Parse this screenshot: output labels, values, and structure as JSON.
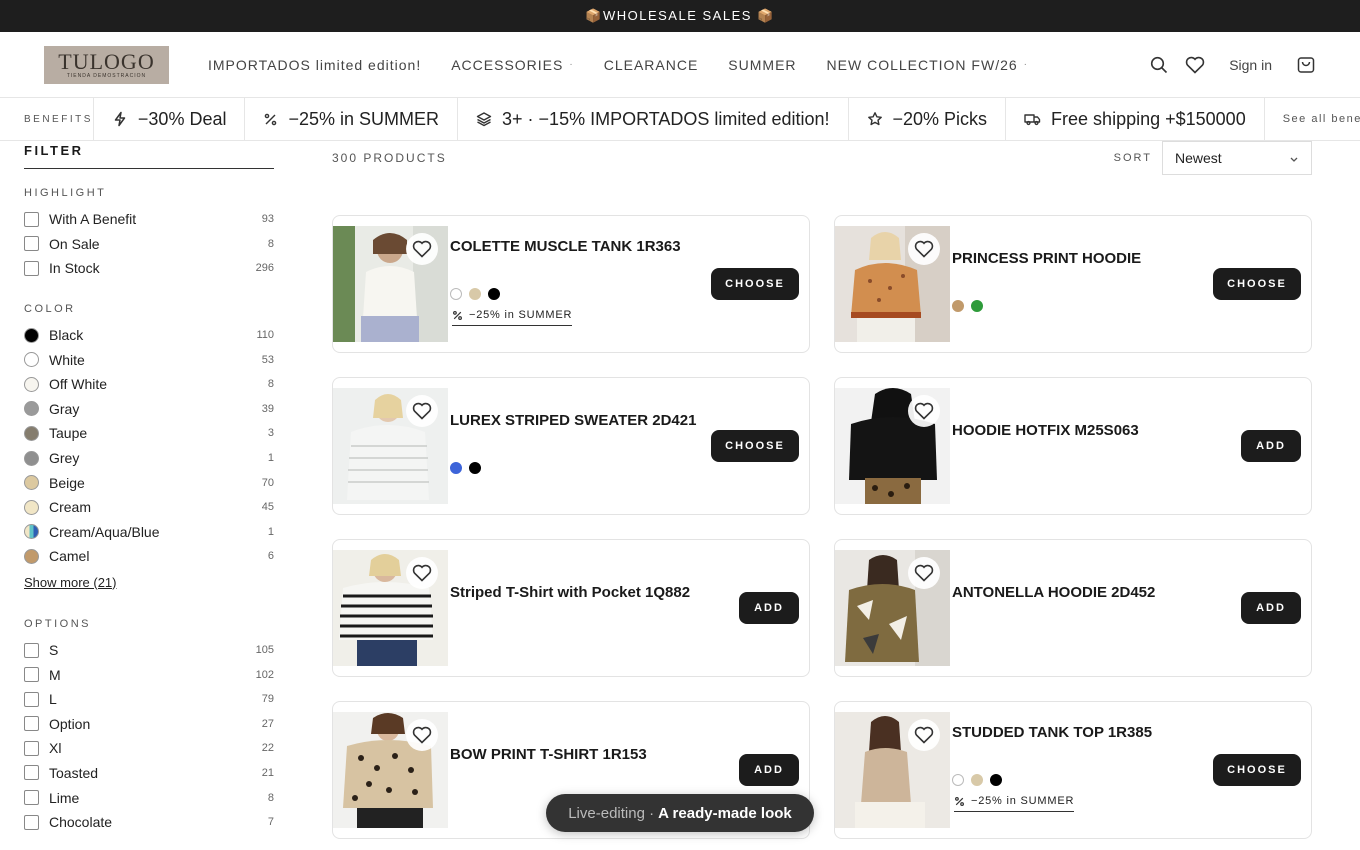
{
  "topbar": {
    "text": "📦WHOLESALE SALES 📦"
  },
  "logo": {
    "main": "TULOGO",
    "sub": "TIENDA DEMOSTRACION"
  },
  "nav": [
    {
      "label": "IMPORTADOS limited edition!",
      "dropdown": false
    },
    {
      "label": "ACCESSORIES",
      "dropdown": true
    },
    {
      "label": "CLEARANCE",
      "dropdown": false
    },
    {
      "label": "SUMMER",
      "dropdown": false
    },
    {
      "label": "NEW COLLECTION FW/26",
      "dropdown": true
    }
  ],
  "header": {
    "signin": "Sign in",
    "icons": [
      "search-icon",
      "heart-icon",
      "cart-icon"
    ]
  },
  "benefits": {
    "label": "BENEFITS",
    "items": [
      {
        "icon": "bolt-icon",
        "text": "−30% Deal"
      },
      {
        "icon": "percent-icon",
        "text": "−25% in SUMMER"
      },
      {
        "icon": "layers-icon",
        "text": "3+ · −15% IMPORTADOS limited edition!"
      },
      {
        "icon": "star-icon",
        "text": "−20% Picks"
      },
      {
        "icon": "truck-icon",
        "text": "Free shipping +$150000"
      }
    ],
    "see_all": "See all benefits →"
  },
  "filter": {
    "title": "FILTER",
    "highlight": {
      "title": "HIGHLIGHT",
      "items": [
        {
          "label": "With A Benefit",
          "count": "93"
        },
        {
          "label": "On Sale",
          "count": "8"
        },
        {
          "label": "In Stock",
          "count": "296"
        }
      ]
    },
    "color": {
      "title": "COLOR",
      "items": [
        {
          "label": "Black",
          "count": "110",
          "color": "#000000"
        },
        {
          "label": "White",
          "count": "53",
          "color": "#ffffff"
        },
        {
          "label": "Off White",
          "count": "8",
          "color": "#f7f5ef"
        },
        {
          "label": "Gray",
          "count": "39",
          "color": "#9a9a9a"
        },
        {
          "label": "Taupe",
          "count": "3",
          "color": "#857d6e"
        },
        {
          "label": "Grey",
          "count": "1",
          "color": "#8f8f8f"
        },
        {
          "label": "Beige",
          "count": "70",
          "color": "#dcc9a0"
        },
        {
          "label": "Cream",
          "count": "45",
          "color": "#f1e6c6"
        },
        {
          "label": "Cream/Aqua/Blue",
          "count": "1",
          "color": "linear-gradient(90deg,#f1e6c6 0%,#f1e6c6 33%,#5fc3c7 33%,#5fc3c7 66%,#2f5fb4 66%)"
        },
        {
          "label": "Camel",
          "count": "6",
          "color": "#c19a6b"
        }
      ],
      "show_more": "Show more (21)"
    },
    "options": {
      "title": "OPTIONS",
      "items": [
        {
          "label": "S",
          "count": "105"
        },
        {
          "label": "M",
          "count": "102"
        },
        {
          "label": "L",
          "count": "79"
        },
        {
          "label": "Option",
          "count": "27"
        },
        {
          "label": "Xl",
          "count": "22"
        },
        {
          "label": "Toasted",
          "count": "21"
        },
        {
          "label": "Lime",
          "count": "8"
        },
        {
          "label": "Chocolate",
          "count": "7"
        }
      ]
    }
  },
  "toolbar": {
    "count": "300 PRODUCTS",
    "sort_label": "SORT",
    "sort_value": "Newest"
  },
  "products": [
    {
      "name": "COLETTE MUSCLE TANK 1R363",
      "action": "CHOOSE",
      "swatches": [
        "#ffffff",
        "#d8c9a8",
        "#000000"
      ],
      "tag": "−25% in SUMMER"
    },
    {
      "name": "PRINCESS PRINT HOODIE",
      "action": "CHOOSE",
      "swatches": [
        "#c19a6b",
        "#2e9b3a"
      ],
      "tag": ""
    },
    {
      "name": "LUREX STRIPED SWEATER 2D421",
      "action": "CHOOSE",
      "swatches": [
        "#3d64d9",
        "#000000"
      ],
      "tag": ""
    },
    {
      "name": "HOODIE HOTFIX M25S063",
      "action": "ADD",
      "swatches": [],
      "tag": ""
    },
    {
      "name": "Striped T-Shirt with Pocket 1Q882",
      "action": "ADD",
      "swatches": [],
      "tag": ""
    },
    {
      "name": "ANTONELLA HOODIE 2D452",
      "action": "ADD",
      "swatches": [],
      "tag": ""
    },
    {
      "name": "BOW PRINT T-SHIRT 1R153",
      "action": "ADD",
      "swatches": [],
      "tag": ""
    },
    {
      "name": "STUDDED TANK TOP 1R385",
      "action": "CHOOSE",
      "swatches": [
        "#ffffff",
        "#d8c9a8",
        "#000000"
      ],
      "tag": "−25% in SUMMER"
    }
  ],
  "toast": {
    "muted": "Live-editing ·",
    "strong": "A ready-made look"
  }
}
